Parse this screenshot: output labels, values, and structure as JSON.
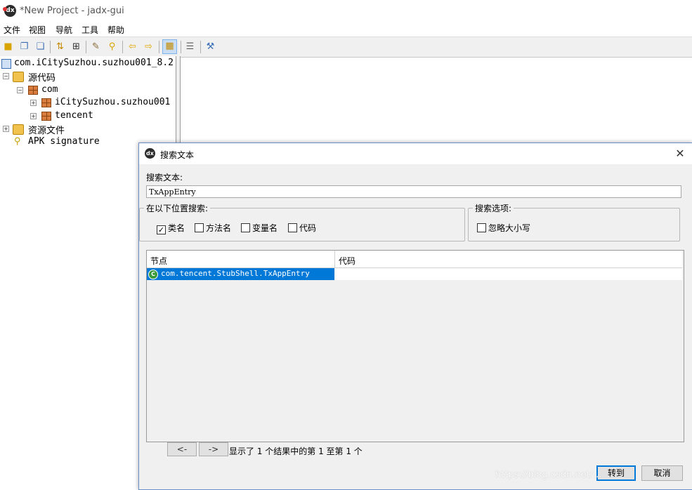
{
  "window": {
    "title": "*New Project - jadx-gui"
  },
  "menu": [
    "文件",
    "视图",
    "导航",
    "工具",
    "帮助"
  ],
  "toolbar": {
    "icons": [
      "open-folder-icon",
      "add-files-icon",
      "save-icon",
      "sync-icon",
      "flatten-icon",
      "search-text-icon",
      "find-class-icon",
      "back-icon",
      "forward-icon",
      "deobfuscation-icon",
      "log-icon",
      "preferences-icon"
    ]
  },
  "tree": {
    "root": "com.iCitySuzhou.suzhou001_8.2",
    "source": "源代码",
    "com": "com",
    "pkg1": "iCitySuzhou.suzhou001",
    "pkg2": "tencent",
    "resources": "资源文件",
    "apk_signature": "APK signature"
  },
  "dialog": {
    "title": "搜索文本",
    "search_label": "搜索文本:",
    "search_value": "TxAppEntry",
    "location_group": "在以下位置搜索:",
    "locations": [
      {
        "label": "类名",
        "checked": "✓"
      },
      {
        "label": "方法名",
        "checked": ""
      },
      {
        "label": "变量名",
        "checked": ""
      },
      {
        "label": "代码",
        "checked": ""
      }
    ],
    "options_group": "搜索选项:",
    "options": [
      {
        "label": "忽略大小写",
        "checked": ""
      }
    ],
    "table": {
      "col_node": "节点",
      "col_code": "代码",
      "rows": [
        {
          "node": "com.tencent.StubShell.TxAppEntry",
          "code": ""
        }
      ]
    },
    "prev_label": "<-",
    "next_label": "->",
    "page_info": "显示了 1 个结果中的第 1 至第 1 个",
    "goto_label": "转到",
    "cancel_label": "取消"
  },
  "watermark": "https://blog.csdn.net/..."
}
